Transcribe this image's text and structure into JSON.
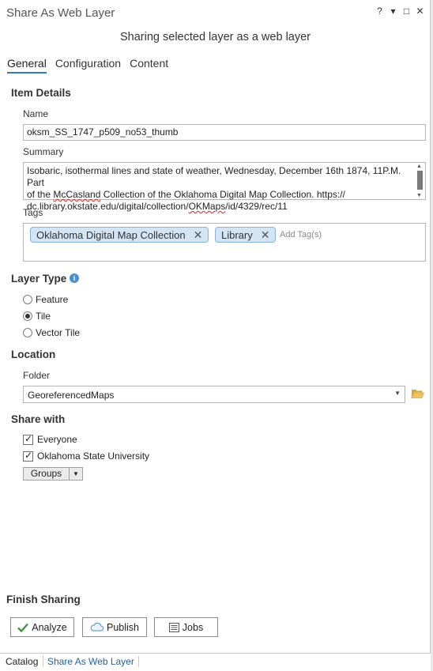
{
  "window": {
    "title": "Share As Web Layer",
    "controls": [
      "?",
      "▾",
      "□",
      "✕"
    ],
    "subtitle": "Sharing selected layer as a web layer"
  },
  "tabs": [
    {
      "label": "General",
      "active": true
    },
    {
      "label": "Configuration",
      "active": false
    },
    {
      "label": "Content",
      "active": false
    }
  ],
  "item_details": {
    "heading": "Item Details",
    "name_label": "Name",
    "name_value": "oksm_SS_1747_p509_no53_thumb",
    "summary_label": "Summary",
    "summary_line1": "Isobaric, isothermal lines and state of weather, Wednesday, December 16th 1874, 11P.M. Part",
    "summary_line2_a": "of the ",
    "summary_line2_b": "McCasland",
    "summary_line2_c": " Collection of the Oklahoma Digital Map Collection. https://",
    "summary_line3_a": "dc.library.okstate.edu/digital/collection/",
    "summary_line3_b": "OKMaps",
    "summary_line3_c": "/id/4329/rec/11",
    "tags_label": "Tags",
    "tags": [
      "Oklahoma Digital Map Collection",
      "Library"
    ],
    "add_tag_placeholder": "Add Tag(s)"
  },
  "layer_type": {
    "heading": "Layer Type",
    "options": [
      {
        "label": "Feature",
        "selected": false
      },
      {
        "label": "Tile",
        "selected": true
      },
      {
        "label": "Vector Tile",
        "selected": false
      }
    ]
  },
  "location": {
    "heading": "Location",
    "folder_label": "Folder",
    "folder_value": "GeoreferencedMaps"
  },
  "share_with": {
    "heading": "Share with",
    "options": [
      {
        "label": "Everyone",
        "checked": true
      },
      {
        "label": "Oklahoma State University",
        "checked": true
      }
    ],
    "groups_label": "Groups"
  },
  "finish": {
    "heading": "Finish Sharing",
    "analyze_label": "Analyze",
    "publish_label": "Publish",
    "jobs_label": "Jobs"
  },
  "bottom_tabs": [
    {
      "label": "Catalog",
      "active": false
    },
    {
      "label": "Share As Web Layer",
      "active": true
    }
  ],
  "colors": {
    "accent": "#2f78c4",
    "chip_bg": "#d3e4f5",
    "chip_border": "#8ab3da",
    "check_green": "#3a9a3a",
    "info_blue": "#4a8fd0",
    "folder_yellow": "#e8b84a"
  }
}
